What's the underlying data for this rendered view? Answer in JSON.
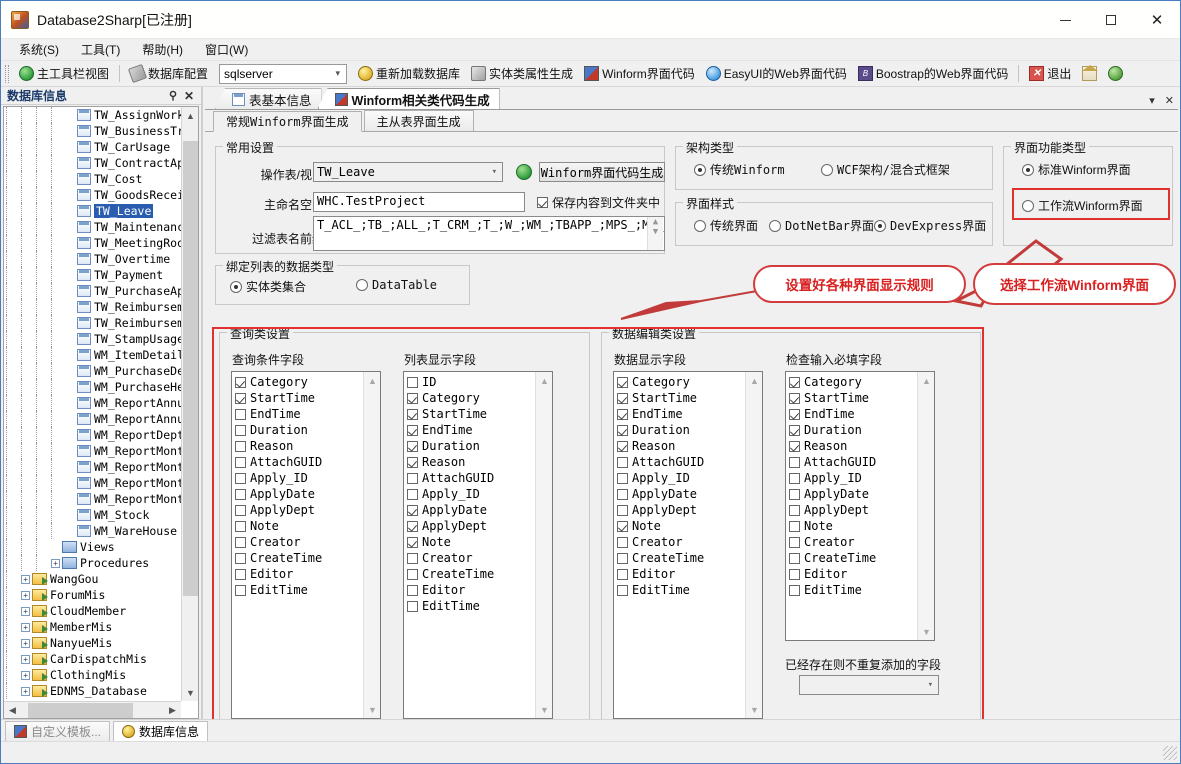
{
  "window": {
    "title": "Database2Sharp[已注册]",
    "app_icon": "app-icon",
    "minimize": "—",
    "maximize": "□",
    "close": "✕"
  },
  "menubar": [
    {
      "label": "系统(S)"
    },
    {
      "label": "工具(T)"
    },
    {
      "label": "帮助(H)"
    },
    {
      "label": "窗口(W)"
    }
  ],
  "toolbar": {
    "items": [
      {
        "label": "主工具栏视图",
        "icon": "globe-icon"
      },
      {
        "label": "数据库配置",
        "icon": "wrench-icon"
      },
      {
        "label": "重新加载数据库",
        "icon": "database-icon"
      },
      {
        "label": "实体类属性生成",
        "icon": "param-icon"
      },
      {
        "label": "Winform界面代码",
        "icon": "winform-icon"
      },
      {
        "label": "EasyUI的Web界面代码",
        "icon": "globe-blue-icon"
      },
      {
        "label": "Boostrap的Web界面代码",
        "icon": "bootstrap-icon"
      },
      {
        "label": "退出",
        "icon": "exit-icon"
      }
    ],
    "db_select_value": "sqlserver",
    "home_icon": "home-icon",
    "rss_icon": "rss-icon"
  },
  "left_panel": {
    "title": "数据库信息",
    "pin_icon": "pin-icon",
    "close_icon": "close-icon",
    "tables": [
      "TW_AssignWork",
      "TW_BusinessTrip",
      "TW_CarUsage",
      "TW_ContractApprc",
      "TW_Cost",
      "TW_GoodsReceive",
      "TW_Leave",
      "TW_Maintenance",
      "TW_MeetingRoom",
      "TW_Overtime",
      "TW_Payment",
      "TW_PurchaseApprc",
      "TW_Reimbursement",
      "TW_Reimbursement",
      "TW_StampUsage",
      "WM_ItemDetail",
      "WM_PurchaseDetai",
      "WM_PurchaseHeade",
      "WM_ReportAnnualC",
      "WM_ReportAnnualC",
      "WM_ReportDeptCos",
      "WM_ReportMonthCh",
      "WM_ReportMonthly",
      "WM_ReportMonthly",
      "WM_ReportMonthly",
      "WM_Stock",
      "WM_WareHouse"
    ],
    "selected_table": "TW_Leave",
    "folders": [
      {
        "label": "Views",
        "expandable": false
      },
      {
        "label": "Procedures",
        "expandable": true
      }
    ],
    "databases": [
      "WangGou",
      "ForumMis",
      "CloudMember",
      "MemberMis",
      "NanyueMis",
      "CarDispatchMis",
      "ClothingMis",
      "EDNMS_Database"
    ]
  },
  "doc_tabs": [
    {
      "label": "表基本信息",
      "icon": "grid-icon",
      "active": false
    },
    {
      "label": "Winform相关类代码生成",
      "icon": "winform-icon",
      "active": true
    }
  ],
  "tab_controls": {
    "dropdown": "▾",
    "close": "✕"
  },
  "sub_tabs": [
    {
      "label": "常规Winform界面生成",
      "active": true
    },
    {
      "label": "主从表界面生成",
      "active": false
    }
  ],
  "common_settings": {
    "caption": "常用设置",
    "table_label": "操作表/视图",
    "table_value": "TW_Leave",
    "refresh_icon": "refresh-icon",
    "generate_button": "Winform界面代码生成",
    "namespace_label": "主命名空间",
    "namespace_value": "WHC.TestProject",
    "save_to_folder_label": "保存内容到文件夹中",
    "save_to_folder_checked": true,
    "prefix_label": "过滤表名前缀",
    "prefix_value": "T_ACL_;TB_;ALL_;T_CRM_;T_;W_;WM_;TBAPP_;MPS_;MS_;YF_;"
  },
  "arch_type": {
    "caption": "架构类型",
    "options": [
      {
        "label": "传统Winform",
        "selected": true
      },
      {
        "label": "WCF架构/混合式框架",
        "selected": false
      }
    ]
  },
  "ui_style": {
    "caption": "界面样式",
    "options": [
      {
        "label": "传统界面",
        "selected": false
      },
      {
        "label": "DotNetBar界面",
        "selected": false
      },
      {
        "label": "DevExpress界面",
        "selected": true
      }
    ]
  },
  "ui_function_type": {
    "caption": "界面功能类型",
    "options": [
      {
        "label": "标准Winform界面",
        "selected": true
      },
      {
        "label": "工作流Winform界面",
        "selected": false
      }
    ]
  },
  "bind_data_type": {
    "caption": "绑定列表的数据类型",
    "options": [
      {
        "label": "实体类集合",
        "selected": true
      },
      {
        "label": "DataTable",
        "selected": false
      }
    ]
  },
  "query_settings": {
    "caption": "查询类设置",
    "cond_label": "查询条件字段",
    "list_label": "列表显示字段",
    "cond_fields": [
      {
        "name": "Category",
        "checked": true
      },
      {
        "name": "StartTime",
        "checked": true
      },
      {
        "name": "EndTime",
        "checked": false
      },
      {
        "name": "Duration",
        "checked": false
      },
      {
        "name": "Reason",
        "checked": false
      },
      {
        "name": "AttachGUID",
        "checked": false
      },
      {
        "name": "Apply_ID",
        "checked": false
      },
      {
        "name": "ApplyDate",
        "checked": false
      },
      {
        "name": "ApplyDept",
        "checked": false
      },
      {
        "name": "Note",
        "checked": false
      },
      {
        "name": "Creator",
        "checked": false
      },
      {
        "name": "CreateTime",
        "checked": false
      },
      {
        "name": "Editor",
        "checked": false
      },
      {
        "name": "EditTime",
        "checked": false
      }
    ],
    "list_fields": [
      {
        "name": "ID",
        "checked": false
      },
      {
        "name": "Category",
        "checked": true
      },
      {
        "name": "StartTime",
        "checked": true
      },
      {
        "name": "EndTime",
        "checked": true
      },
      {
        "name": "Duration",
        "checked": true
      },
      {
        "name": "Reason",
        "checked": true
      },
      {
        "name": "AttachGUID",
        "checked": false
      },
      {
        "name": "Apply_ID",
        "checked": false
      },
      {
        "name": "ApplyDate",
        "checked": true
      },
      {
        "name": "ApplyDept",
        "checked": true
      },
      {
        "name": "Note",
        "checked": true
      },
      {
        "name": "Creator",
        "checked": false
      },
      {
        "name": "CreateTime",
        "checked": false
      },
      {
        "name": "Editor",
        "checked": false
      },
      {
        "name": "EditTime",
        "checked": false
      }
    ]
  },
  "edit_settings": {
    "caption": "数据编辑类设置",
    "display_label": "数据显示字段",
    "required_label": "检查输入必填字段",
    "dup_label": "已经存在则不重复添加的字段",
    "dup_value": "",
    "display_fields": [
      {
        "name": "Category",
        "checked": true
      },
      {
        "name": "StartTime",
        "checked": true
      },
      {
        "name": "EndTime",
        "checked": true
      },
      {
        "name": "Duration",
        "checked": true
      },
      {
        "name": "Reason",
        "checked": true
      },
      {
        "name": "AttachGUID",
        "checked": false
      },
      {
        "name": "Apply_ID",
        "checked": false
      },
      {
        "name": "ApplyDate",
        "checked": false
      },
      {
        "name": "ApplyDept",
        "checked": false
      },
      {
        "name": "Note",
        "checked": true
      },
      {
        "name": "Creator",
        "checked": false
      },
      {
        "name": "CreateTime",
        "checked": false
      },
      {
        "name": "Editor",
        "checked": false
      },
      {
        "name": "EditTime",
        "checked": false
      }
    ],
    "required_fields": [
      {
        "name": "Category",
        "checked": true
      },
      {
        "name": "StartTime",
        "checked": true
      },
      {
        "name": "EndTime",
        "checked": true
      },
      {
        "name": "Duration",
        "checked": true
      },
      {
        "name": "Reason",
        "checked": true
      },
      {
        "name": "AttachGUID",
        "checked": false
      },
      {
        "name": "Apply_ID",
        "checked": false
      },
      {
        "name": "ApplyDate",
        "checked": false
      },
      {
        "name": "ApplyDept",
        "checked": false
      },
      {
        "name": "Note",
        "checked": false
      },
      {
        "name": "Creator",
        "checked": false
      },
      {
        "name": "CreateTime",
        "checked": false
      },
      {
        "name": "Editor",
        "checked": false
      },
      {
        "name": "EditTime",
        "checked": false
      }
    ]
  },
  "annotations": {
    "callout_left": "设置好各种界面显示规则",
    "callout_right": "选择工作流Winform界面",
    "highlight_color": "#e03030"
  },
  "bottom_tabs": [
    {
      "label": "自定义模板...",
      "icon": "template-icon",
      "active": false
    },
    {
      "label": "数据库信息",
      "icon": "database-icon",
      "active": true
    }
  ]
}
